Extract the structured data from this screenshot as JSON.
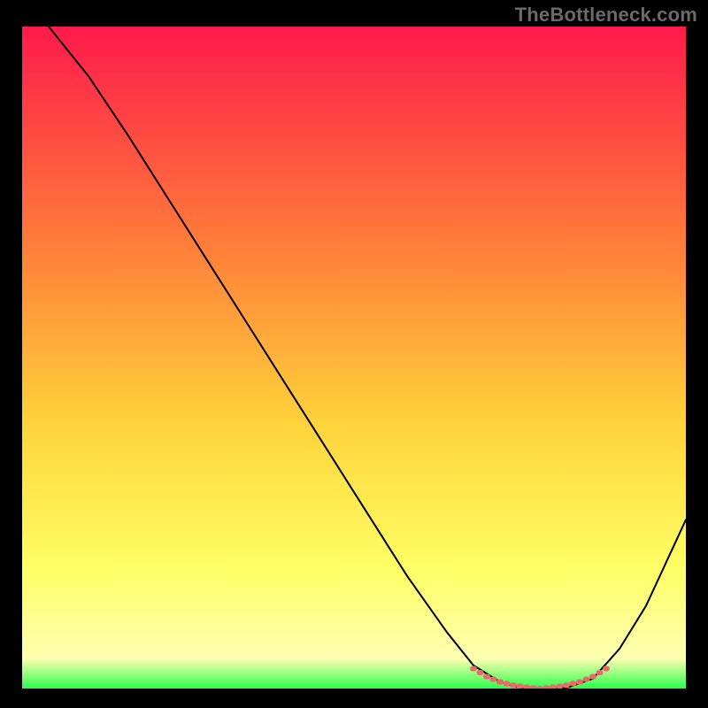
{
  "watermark": "TheBottleneck.com",
  "chart_data": {
    "type": "line",
    "title": "",
    "xlabel": "",
    "ylabel": "",
    "xlim": [
      0,
      100
    ],
    "ylim": [
      0,
      100
    ],
    "grid": false,
    "plot_bg_gradient": {
      "start": "#ff1a4b",
      "via1": "#ff7a3a",
      "via2": "#ffd33a",
      "via3": "#ffff66",
      "via4": "#fdffb0",
      "end": "#2bff4b"
    },
    "series": [
      {
        "name": "bottleneck-curve",
        "color": "#000000",
        "width": 2,
        "x": [
          4,
          10,
          16,
          22,
          28,
          34,
          40,
          46,
          52,
          58,
          64,
          68,
          72,
          75,
          78,
          82,
          86,
          90,
          94,
          100
        ],
        "y": [
          100,
          92.5,
          83.5,
          74,
          64.5,
          55,
          45.5,
          36,
          26.5,
          17,
          8.5,
          3.5,
          1.0,
          0.1,
          0.0,
          0.1,
          1.5,
          6.0,
          12.5,
          25.5
        ]
      },
      {
        "name": "bottom-accent-dots",
        "color": "#e96a6a",
        "width": 4,
        "style": "dotted",
        "x": [
          68,
          70,
          72,
          74,
          76,
          78,
          80,
          82,
          84,
          86,
          88
        ],
        "y": [
          3.0,
          1.8,
          1.0,
          0.5,
          0.2,
          0.0,
          0.2,
          0.5,
          1.0,
          1.8,
          3.0
        ]
      }
    ],
    "legend": null
  }
}
